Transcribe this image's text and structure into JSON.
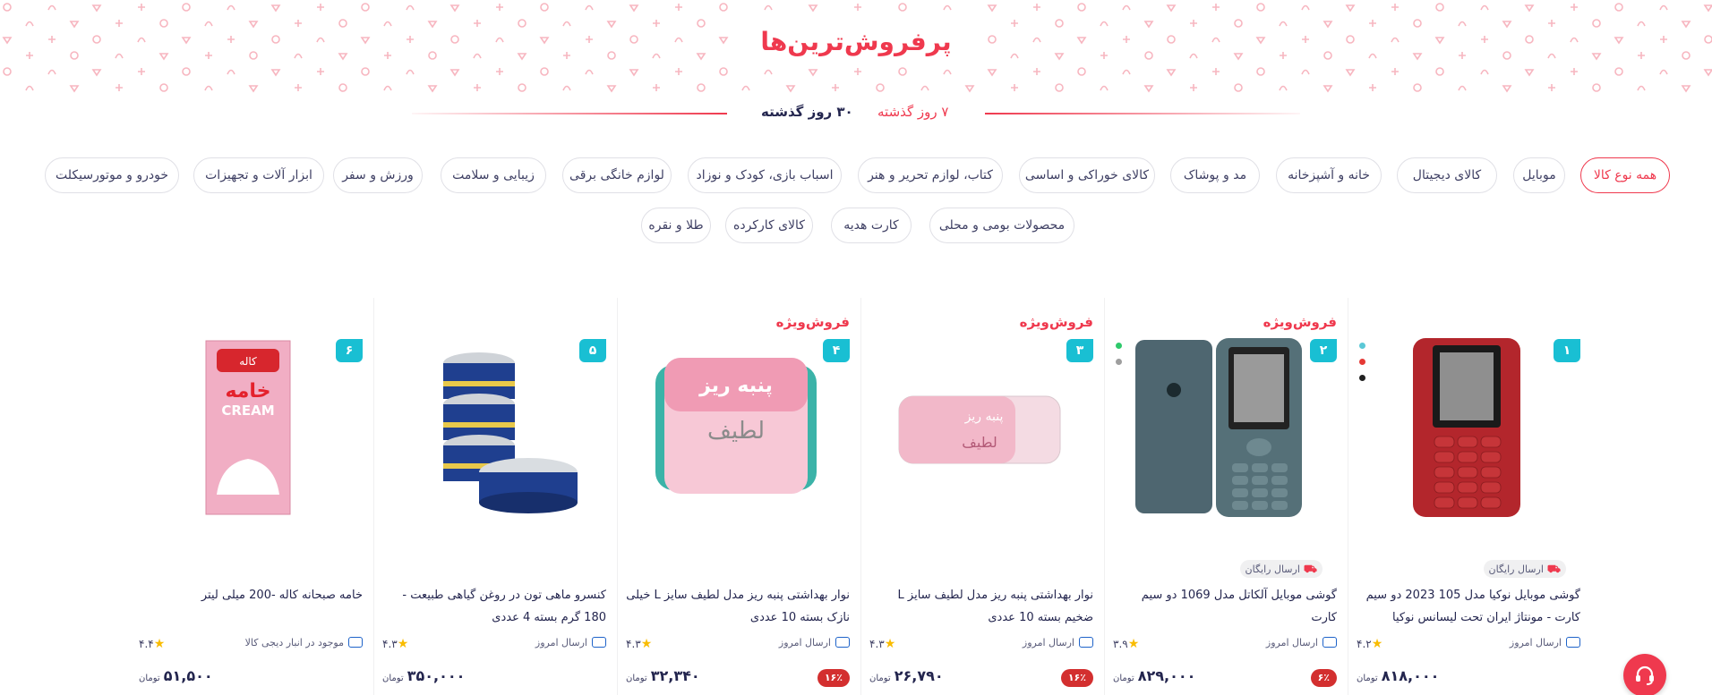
{
  "section": {
    "title": "پرفروش‌ترین‌ها",
    "periods": [
      {
        "label": "۷ روز گذشته",
        "active": true
      },
      {
        "label": "۳۰ روز گذشته",
        "active": false
      }
    ]
  },
  "categories": [
    {
      "label": "همه نوع کالا",
      "active": true
    },
    {
      "label": "موبایل"
    },
    {
      "label": "کالای دیجیتال"
    },
    {
      "label": "خانه و آشپزخانه"
    },
    {
      "label": "مد و پوشاک"
    },
    {
      "label": "کالای خوراکی و اساسی"
    },
    {
      "label": "کتاب، لوازم تحریر و هنر"
    },
    {
      "label": "اسباب بازی، کودک و نوزاد"
    },
    {
      "label": "لوازم خانگی برقی"
    },
    {
      "label": "زیبایی و سلامت"
    },
    {
      "label": "ورزش و سفر"
    },
    {
      "label": "ابزار آلات و تجهیزات"
    },
    {
      "label": "خودرو و موتورسیکلت"
    },
    {
      "label": "محصولات بومی و محلی"
    },
    {
      "label": "کارت هدیه"
    },
    {
      "label": "کالای کارکرده"
    },
    {
      "label": "طلا و نقره"
    }
  ],
  "products": [
    {
      "rank": "۱",
      "special_label": "",
      "free_shipping": "ارسال رایگان",
      "name": "گوشی موبایل نوکیا مدل 105 2023 دو سیم کارت - مونتاژ ایران تحت لیسانس نوکیا",
      "shipping": "ارسال امروز",
      "rating": "۴.۲",
      "discount": "",
      "price": "۸۱۸,۰۰۰",
      "currency": "تومان",
      "colors": [
        "#5bc8d6",
        "#e53935",
        "#212121"
      ],
      "image_icon": "red-phone-image"
    },
    {
      "rank": "۲",
      "special_label": "فروش‌ویژه",
      "free_shipping": "ارسال رایگان",
      "name": "گوشی موبایل آلکاتل مدل 1069 دو سیم کارت",
      "shipping": "ارسال امروز",
      "rating": "۳.۹",
      "discount": "۶٪",
      "price": "۸۲۹,۰۰۰",
      "currency": "تومان",
      "colors": [
        "#2ec96b",
        "#9e9e9e"
      ],
      "image_icon": "gray-phone-image"
    },
    {
      "rank": "۳",
      "special_label": "فروش‌ویژه",
      "free_shipping": "",
      "name": "نوار بهداشتی پنبه ریز مدل لطیف سایز L ضخیم بسته 10 عددی",
      "shipping": "ارسال امروز",
      "rating": "۴.۳",
      "discount": "۱۶٪",
      "price": "۲۶,۷۹۰",
      "currency": "تومان",
      "colors": [],
      "image_icon": "pad-pack-flat-image",
      "pack_brand": "پنبه ریز",
      "pack_sub": "لطیف"
    },
    {
      "rank": "۴",
      "special_label": "فروش‌ویژه",
      "free_shipping": "",
      "name": "نوار بهداشتی پنبه ریز مدل لطیف سایز L خیلی نازک بسته 10 عددی",
      "shipping": "ارسال امروز",
      "rating": "۴.۳",
      "discount": "۱۶٪",
      "price": "۳۲,۳۴۰",
      "currency": "تومان",
      "colors": [],
      "image_icon": "pad-pack-image",
      "pack_brand": "پنبه ریز",
      "pack_sub": "لطیف"
    },
    {
      "rank": "۵",
      "special_label": "",
      "free_shipping": "",
      "name": "کنسرو ماهی تون در روغن گیاهی طبیعت - 180 گرم بسته 4 عددی",
      "shipping": "ارسال امروز",
      "rating": "۴.۳",
      "discount": "",
      "price": "۳۵۰,۰۰۰",
      "currency": "تومان",
      "colors": [],
      "image_icon": "tuna-cans-image"
    },
    {
      "rank": "۶",
      "special_label": "",
      "free_shipping": "",
      "name": "خامه صبحانه کاله -200 میلی لیتر",
      "shipping": "موجود در انبار دیجی کالا",
      "rating": "۴.۴",
      "discount": "",
      "price": "۵۱,۵۰۰",
      "currency": "تومان",
      "colors": [],
      "image_icon": "cream-box-image",
      "pack_brand": "کاله",
      "pack_sub": "خامه",
      "pack_en": "CREAM"
    }
  ],
  "support_icon": "headset-icon"
}
